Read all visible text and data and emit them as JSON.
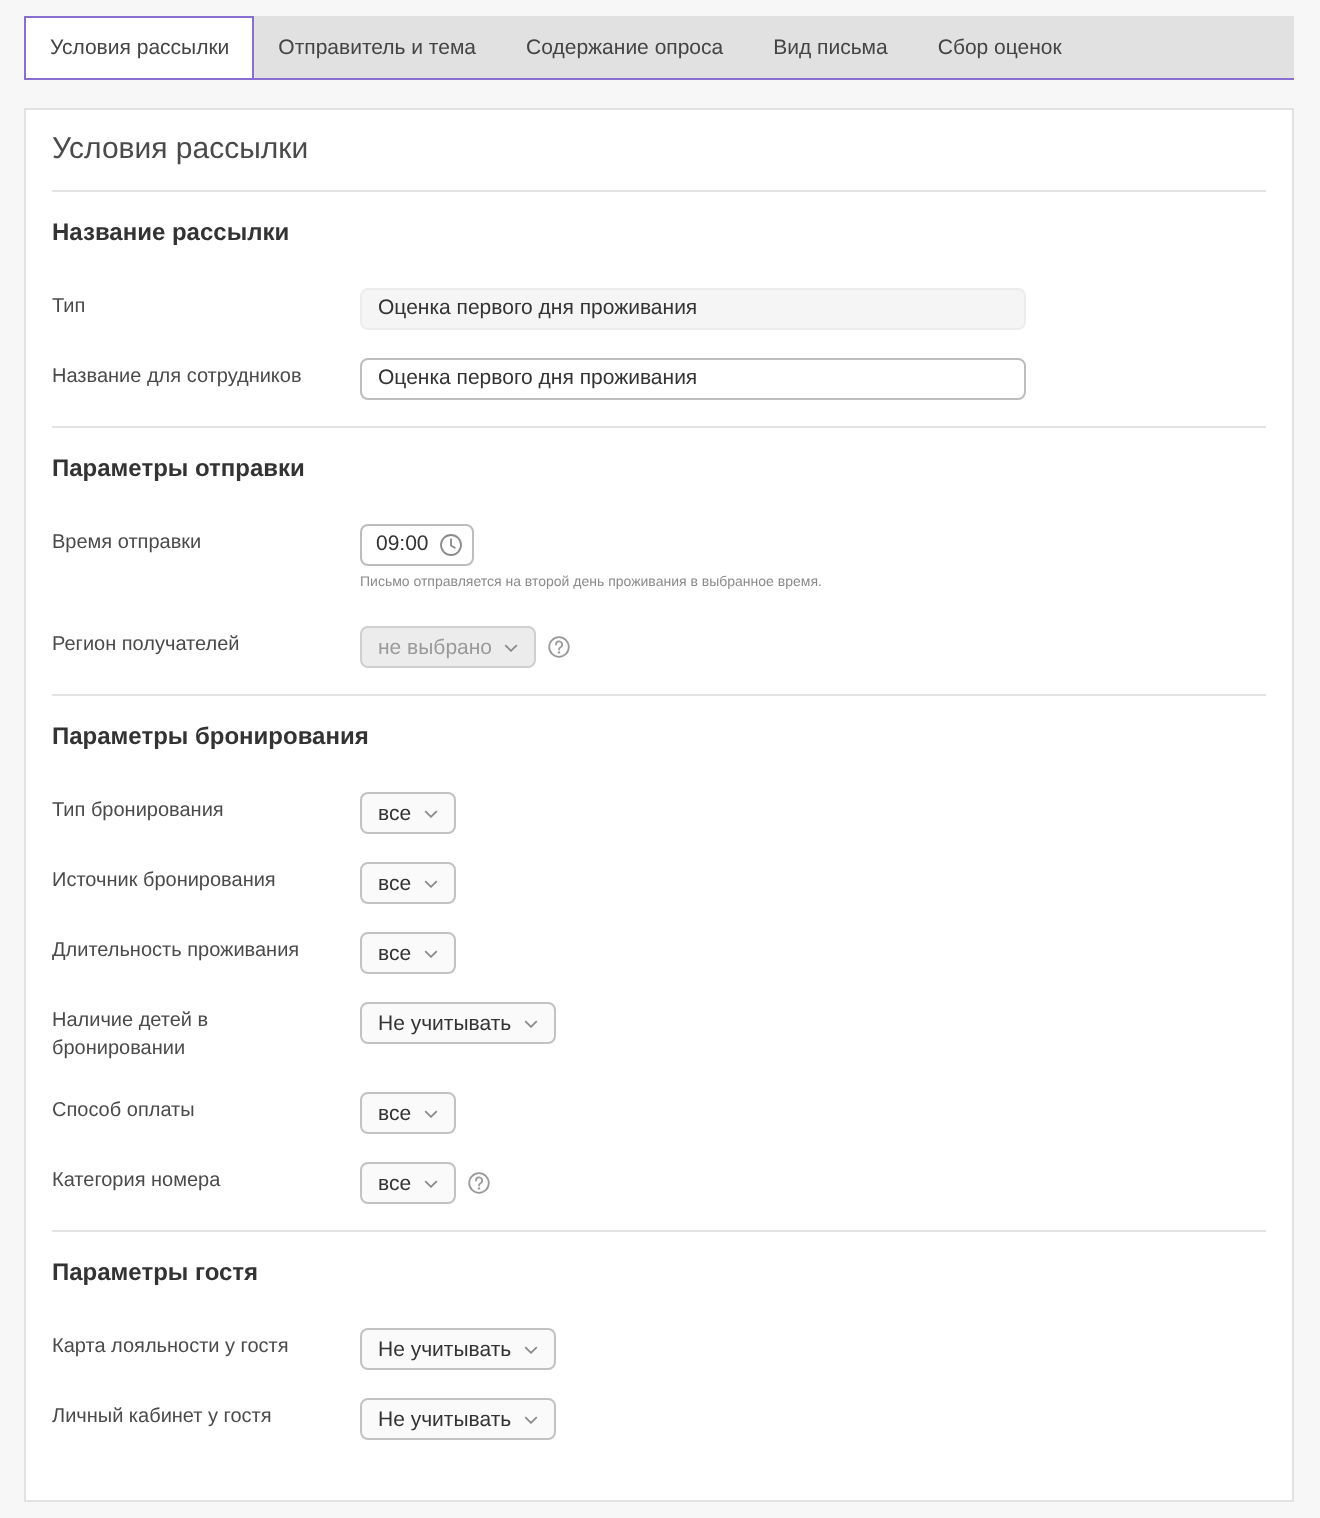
{
  "tabs": [
    {
      "label": "Условия рассылки",
      "selected": true
    },
    {
      "label": "Отправитель и тема",
      "selected": false
    },
    {
      "label": "Содержание опроса",
      "selected": false
    },
    {
      "label": "Вид письма",
      "selected": false
    },
    {
      "label": "Сбор оценок",
      "selected": false
    }
  ],
  "panel": {
    "title": "Условия рассылки",
    "sections": [
      {
        "heading": "Название рассылки",
        "fields": [
          {
            "label": "Тип",
            "kind": "text",
            "value": "Оценка первого дня проживания",
            "disabled": true,
            "help": false
          },
          {
            "label": "Название для сотрудников",
            "kind": "text",
            "value": "Оценка первого дня проживания",
            "disabled": false,
            "help": false
          }
        ]
      },
      {
        "heading": "Параметры отправки",
        "fields": [
          {
            "label": "Время отправки",
            "kind": "time",
            "value": "09:00",
            "hint": "Письмо отправляется на второй день проживания в выбранное время.",
            "disabled": false,
            "help": false
          },
          {
            "label": "Регион получателей",
            "kind": "select",
            "value": "не выбрано",
            "disabled": true,
            "help": true
          }
        ]
      },
      {
        "heading": "Параметры бронирования",
        "fields": [
          {
            "label": "Тип бронирования",
            "kind": "select",
            "value": "все",
            "disabled": false,
            "help": false
          },
          {
            "label": "Источник бронирования",
            "kind": "select",
            "value": "все",
            "disabled": false,
            "help": false
          },
          {
            "label": "Длительность проживания",
            "kind": "select",
            "value": "все",
            "disabled": false,
            "help": false
          },
          {
            "label": "Наличие детей в бронировании",
            "kind": "select",
            "value": "Не учитывать",
            "disabled": false,
            "help": false
          },
          {
            "label": "Способ оплаты",
            "kind": "select",
            "value": "все",
            "disabled": false,
            "help": false
          },
          {
            "label": "Категория номера",
            "kind": "select",
            "value": "все",
            "disabled": false,
            "help": true
          }
        ]
      },
      {
        "heading": "Параметры гостя",
        "fields": [
          {
            "label": "Карта лояльности у гостя",
            "kind": "select",
            "value": "Не учитывать",
            "disabled": false,
            "help": false
          },
          {
            "label": "Личный кабинет у гостя",
            "kind": "select",
            "value": "Не учитывать",
            "disabled": false,
            "help": false
          }
        ]
      }
    ]
  }
}
